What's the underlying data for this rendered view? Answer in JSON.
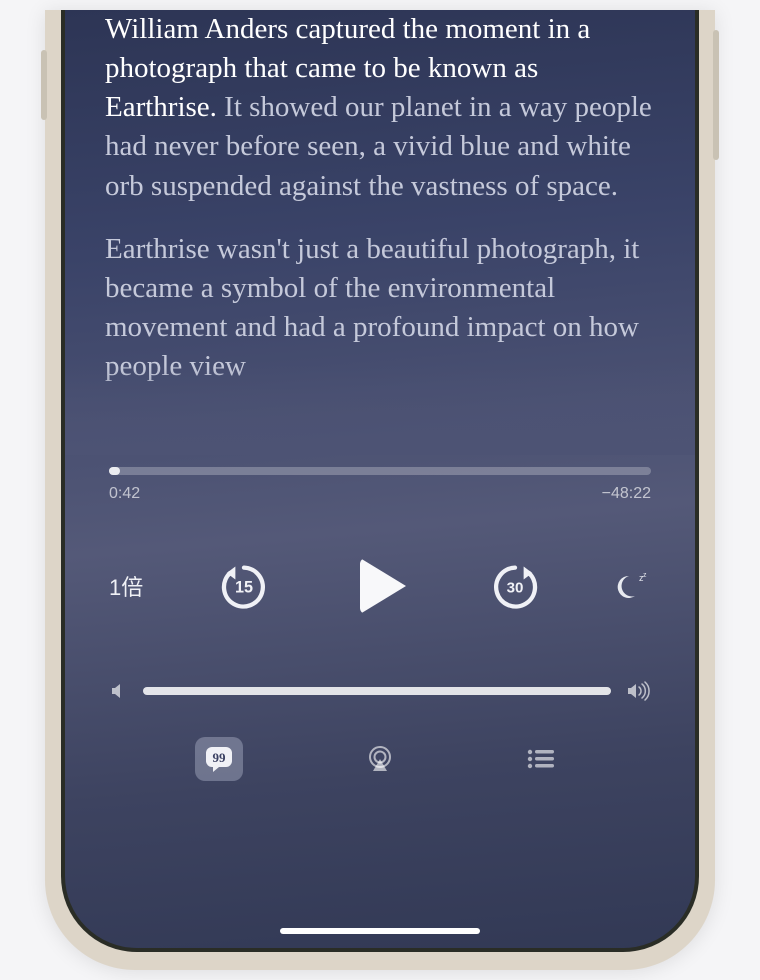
{
  "transcript": {
    "highlighted": "William Anders captured the moment in a photograph that came to be known as Earthrise.",
    "para1_rest": " It showed our planet in a way people had never before seen, a vivid blue and white orb suspended against the vastness of space.",
    "para2": "Earthrise wasn't just a beautiful photograph, it became a symbol of the environmental movement and had a profound impact on how people view"
  },
  "player": {
    "elapsed": "0:42",
    "remaining": "−48:22",
    "progress_percent": 1.5,
    "speed_label": "1倍",
    "skip_back_seconds": "15",
    "skip_forward_seconds": "30",
    "volume_percent": 100
  },
  "icons": {
    "sleep": "sleep-timer-icon",
    "transcript_tab": "transcript-tab-icon",
    "airplay_tab": "airplay-icon",
    "queue_tab": "queue-list-icon"
  }
}
